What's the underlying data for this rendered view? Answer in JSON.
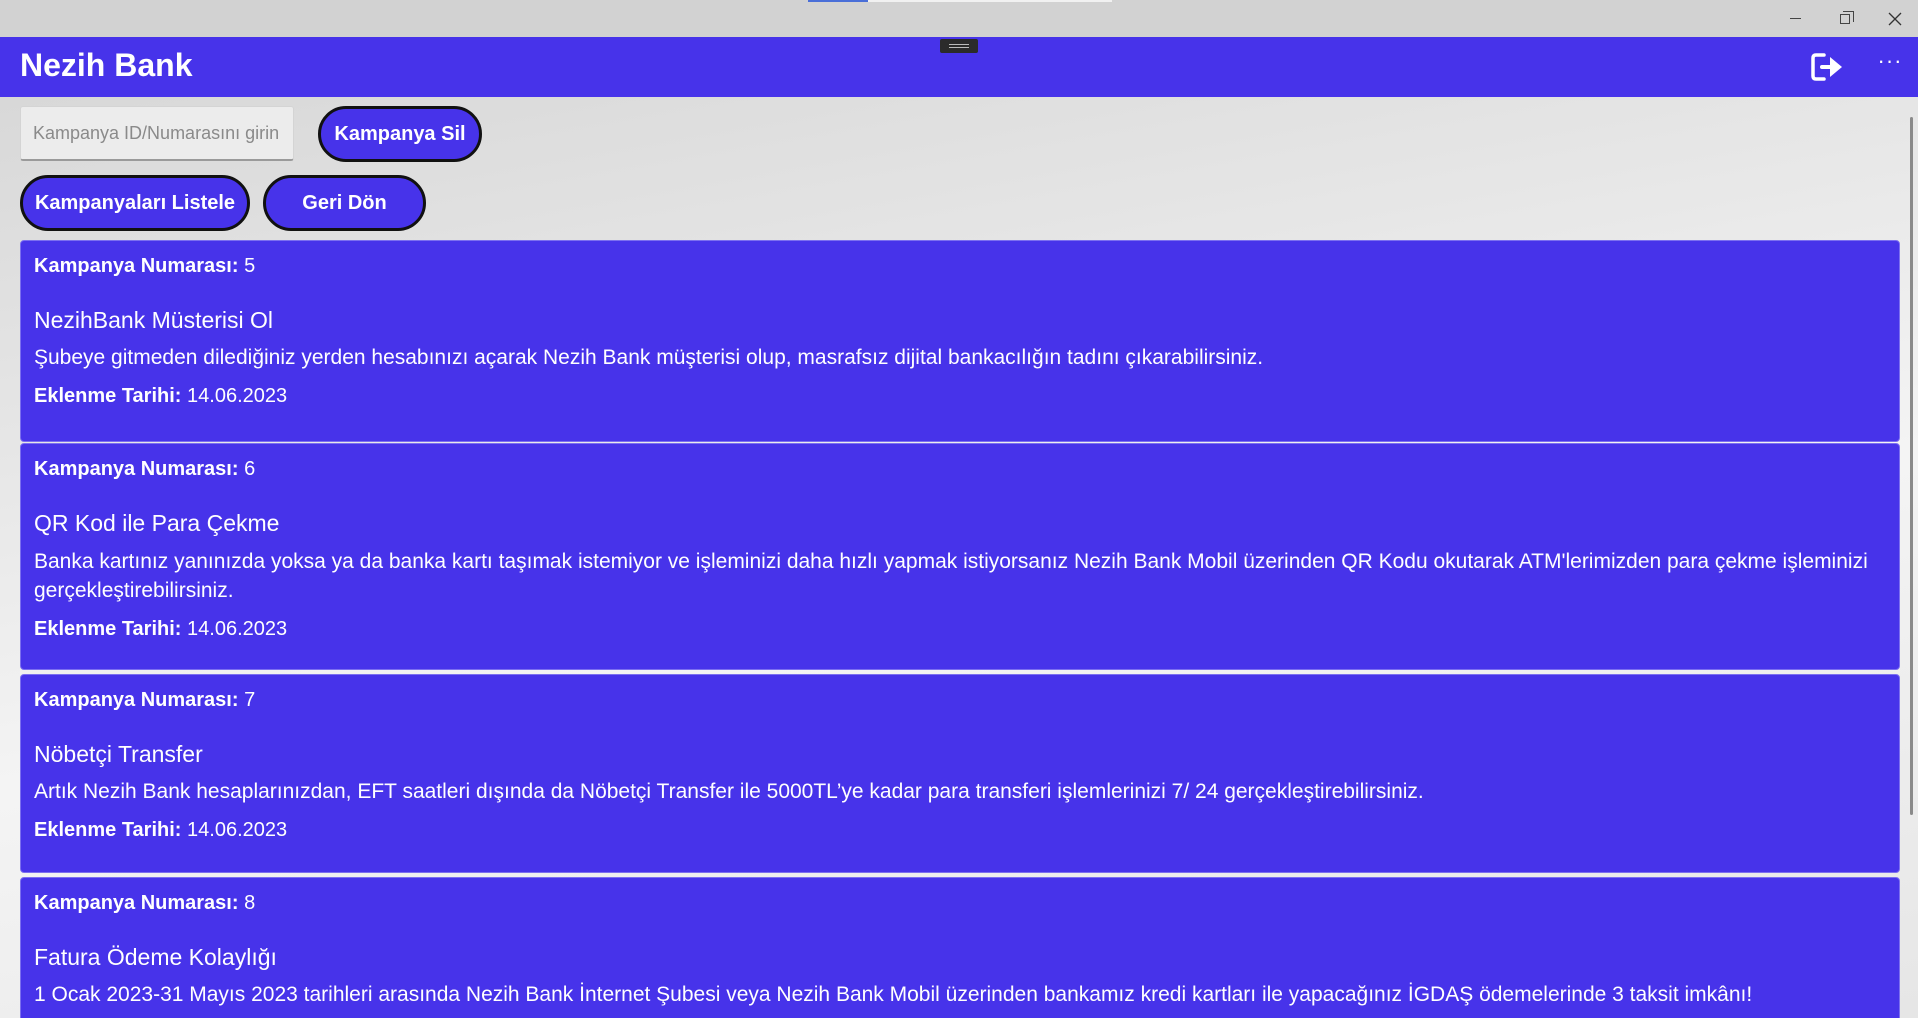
{
  "header": {
    "brand": "Nezih Bank",
    "logout_icon": "logout-icon",
    "more_icon": "more-icon",
    "more_glyph": "···"
  },
  "search": {
    "placeholder": "Kampanya ID/Numarasını girin",
    "value": ""
  },
  "actions": {
    "delete_label": "Kampanya Sil",
    "list_label": "Kampanyaları Listele",
    "back_label": "Geri Dön"
  },
  "labels": {
    "number_label": "Kampanya Numarası:",
    "date_label": "Eklenme Tarihi:"
  },
  "campaigns": [
    {
      "number": "5",
      "title": "NezihBank Müsterisi Ol",
      "description": "Şubeye gitmeden dilediğiniz yerden hesabınızı açarak Nezih Bank müşterisi olup, masrafsız dijital bankacılığın tadını çıkarabilirsiniz.",
      "date": "14.06.2023"
    },
    {
      "number": "6",
      "title": "QR Kod ile Para Çekme",
      "description": "Banka kartınız yanınızda yoksa ya da banka kartı taşımak istemiyor ve işleminizi daha hızlı yapmak istiyorsanız Nezih Bank Mobil üzerinden QR Kodu okutarak ATM'lerimizden para çekme işleminizi gerçekleştirebilirsiniz.",
      "date": "14.06.2023"
    },
    {
      "number": "7",
      "title": "Nöbetçi Transfer",
      "description": "Artık Nezih Bank hesaplarınızdan, EFT saatleri dışında da Nöbetçi Transfer ile 5000TL’ye kadar para transferi işlemlerinizi 7/ 24 gerçekleştirebilirsiniz.",
      "date": "14.06.2023"
    },
    {
      "number": "8",
      "title": "Fatura Ödeme Kolaylığı",
      "description": "1 Ocak 2023-31 Mayıs 2023 tarihleri arasında Nezih Bank İnternet Şubesi veya Nezih Bank Mobil üzerinden bankamız kredi kartları ile yapacağınız İGDAŞ ödemelerinde 3 taksit imkânı!",
      "date": ""
    }
  ],
  "colors": {
    "accent": "#4733ea",
    "button_border": "#111111"
  }
}
